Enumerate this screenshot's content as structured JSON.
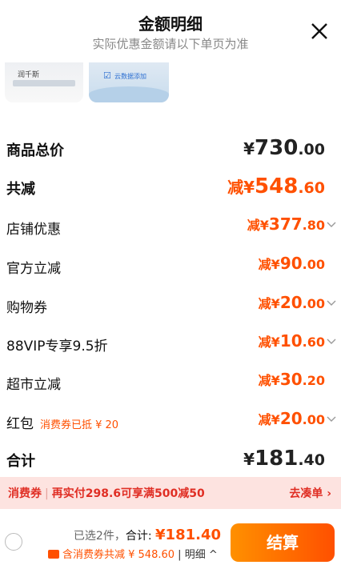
{
  "header": {
    "title": "金额明细",
    "subtitle": "实际优惠金额请以下单页为准"
  },
  "thumbs": {
    "item1_text": "润千斯",
    "item2_text": "云数据添加"
  },
  "rows": {
    "total_price": {
      "label": "商品总价",
      "prefix": "¥",
      "int": "730",
      "dec": ".00"
    },
    "total_reduce": {
      "label": "共减",
      "prefix": "减¥",
      "int": "548",
      "dec": ".60"
    },
    "store": {
      "label": "店铺优惠",
      "prefix": "减¥",
      "int": "377",
      "dec": ".80"
    },
    "official": {
      "label": "官方立减",
      "prefix": "减¥",
      "int": "90",
      "dec": ".00"
    },
    "shopping_coupon": {
      "label": "购物券",
      "prefix": "减¥",
      "int": "20",
      "dec": ".00"
    },
    "vip": {
      "label": "88VIP专享9.5折",
      "prefix": "减¥",
      "int": "10",
      "dec": ".60"
    },
    "supermarket": {
      "label": "超市立减",
      "prefix": "减¥",
      "int": "30",
      "dec": ".20"
    },
    "redpacket": {
      "label": "红包",
      "note": "消费券已抵 ¥ 20",
      "prefix": "减¥",
      "int": "20",
      "dec": ".00"
    },
    "sum": {
      "label": "合计",
      "prefix": "¥",
      "int": "181",
      "dec": ".40"
    }
  },
  "banner": {
    "tag": "消费券",
    "text": "再实付298.6可享满500减50",
    "action": "去凑单 ›"
  },
  "footer": {
    "selected": "已选2件，",
    "sum_label": "合计:",
    "total": "¥181.40",
    "coupon_text": "含消费券共减 ¥ 548.60",
    "detail": "明细 ^",
    "pay_button": "结算"
  },
  "colors": {
    "accent": "#ff5000",
    "banner_bg": "#fde3e0",
    "banner_text": "#e02e24"
  }
}
